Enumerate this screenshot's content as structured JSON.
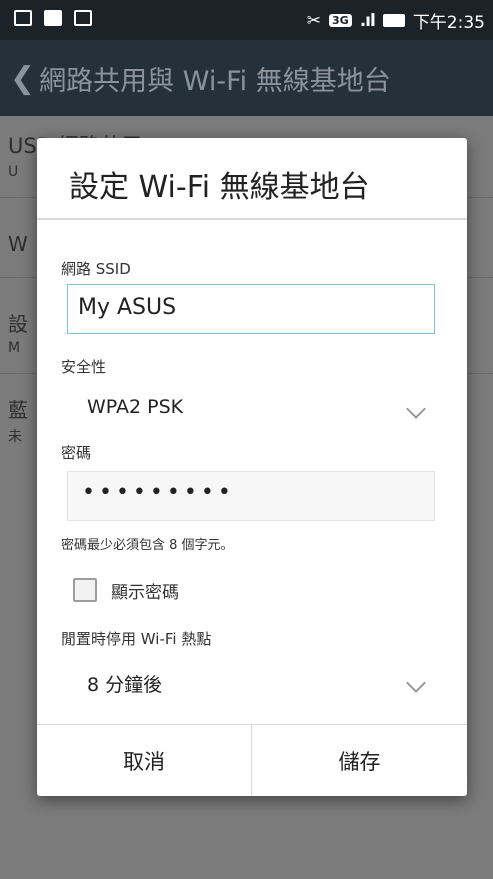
{
  "status_bar": {
    "network_badge": "3G",
    "signal": ".ıl",
    "time": "下午2:35"
  },
  "app_bar": {
    "title": "網路共用與 Wi-Fi 無線基地台"
  },
  "background_list": {
    "item1_title": "USB 網路共用",
    "item1_sub": "U",
    "item2_title": "W",
    "item3_title": "設",
    "item3_sub": "M",
    "item4_title": "藍",
    "item4_sub": "未"
  },
  "dialog": {
    "title": "設定 Wi-Fi 無線基地台",
    "ssid_label": "網路 SSID",
    "ssid_value": "My ASUS",
    "security_label": "安全性",
    "security_value": "WPA2 PSK",
    "password_label": "密碼",
    "password_value": "•••••••••",
    "password_hint": "密碼最少必須包含 8 個字元。",
    "show_password_label": "顯示密碼",
    "idle_label": "閒置時停用 Wi-Fi 熱點",
    "idle_value": "8 分鐘後",
    "cancel_label": "取消",
    "save_label": "儲存"
  }
}
